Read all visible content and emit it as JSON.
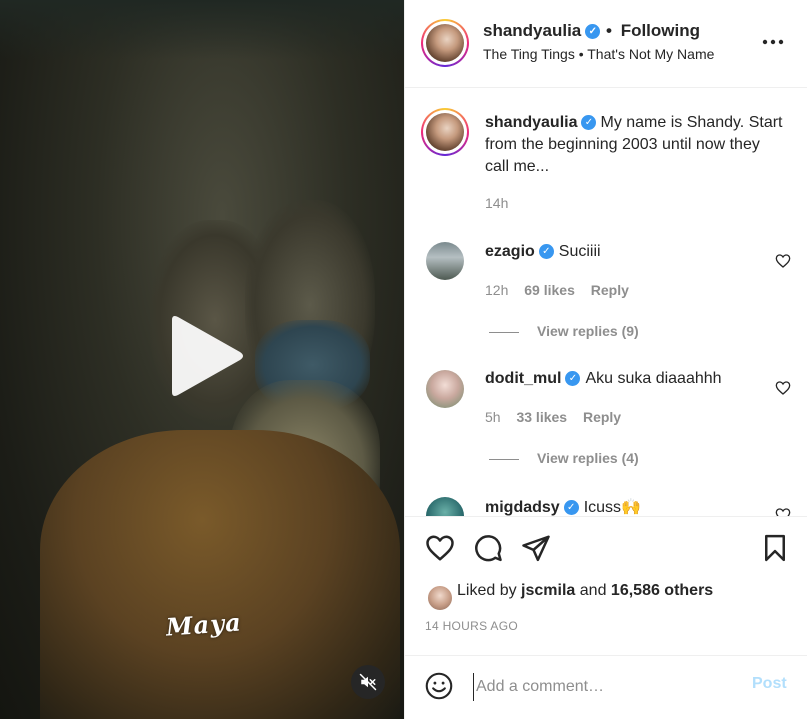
{
  "media": {
    "overlay_text": "Maya",
    "play_icon": "play-icon",
    "mute_icon": "speaker-muted-icon"
  },
  "header": {
    "username": "shandyaulia",
    "separator": "•",
    "follow_status": "Following",
    "audio": "The Ting Tings • That's Not My Name",
    "more_icon": "more-options-icon"
  },
  "caption": {
    "username": "shandyaulia",
    "text": "My name is Shandy. Start from the beginning 2003 until now they call me...",
    "time": "14h"
  },
  "comments": [
    {
      "username": "ezagio",
      "text": "Suciiii",
      "time": "12h",
      "likes": "69 likes",
      "reply": "Reply",
      "view_replies": "View replies (9)"
    },
    {
      "username": "dodit_mul",
      "text": "Aku suka diaaahhh",
      "time": "5h",
      "likes": "33 likes",
      "reply": "Reply",
      "view_replies": "View replies (4)"
    },
    {
      "username": "migdadsy",
      "text": "Icuss🙌"
    }
  ],
  "actions": {
    "liked_prefix": "Liked by",
    "liked_user": "jscmila",
    "liked_and": "and",
    "liked_others": "16,586 others",
    "posted_ago": "14 HOURS AGO"
  },
  "composer": {
    "placeholder": "Add a comment…",
    "post_label": "Post"
  },
  "colors": {
    "accent": "#3897f0",
    "post_disabled": "#b2dffc",
    "muted_text": "#8e8e8e"
  }
}
